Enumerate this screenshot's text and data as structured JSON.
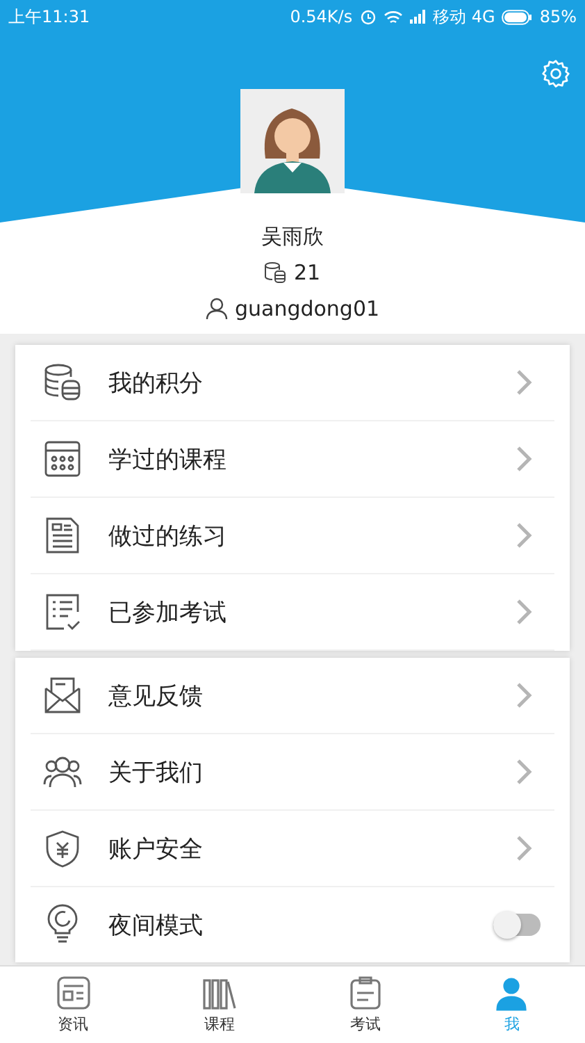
{
  "status_bar": {
    "time": "上午11:31",
    "speed": "0.54K/s",
    "carrier": "移动 4G",
    "battery": "85%"
  },
  "profile": {
    "name": "吴雨欣",
    "points": "21",
    "username": "guangdong01"
  },
  "menu_groups": [
    {
      "items": [
        {
          "kind": "points",
          "label": "我的积分"
        },
        {
          "kind": "courses",
          "label": "学过的课程"
        },
        {
          "kind": "exercises",
          "label": "做过的练习"
        },
        {
          "kind": "exams",
          "label": "已参加考试"
        }
      ]
    },
    {
      "items": [
        {
          "kind": "feedback",
          "label": "意见反馈"
        },
        {
          "kind": "about",
          "label": "关于我们"
        },
        {
          "kind": "security",
          "label": "账户安全"
        },
        {
          "kind": "night",
          "label": "夜间模式",
          "on": false
        }
      ]
    }
  ],
  "bottom_nav": [
    {
      "kind": "news",
      "label": "资讯",
      "selected": false
    },
    {
      "kind": "courses",
      "label": "课程",
      "selected": false
    },
    {
      "kind": "exam",
      "label": "考试",
      "selected": false
    },
    {
      "kind": "me",
      "label": "我",
      "selected": true
    }
  ]
}
